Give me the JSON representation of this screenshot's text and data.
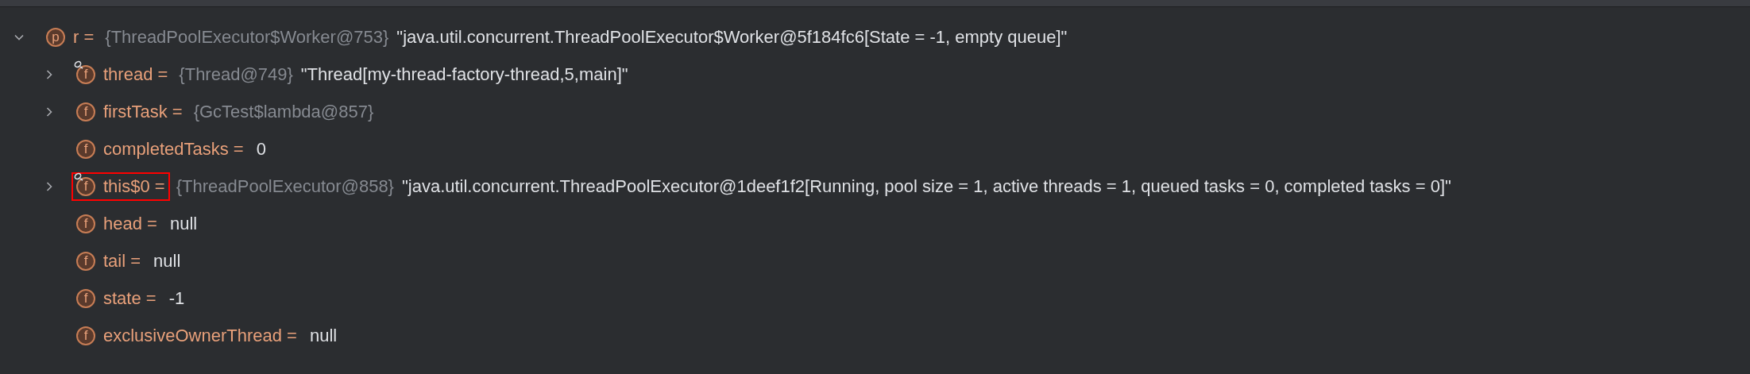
{
  "variables": [
    {
      "icon": "p",
      "label": "r =",
      "type": "{ThreadPoolExecutor$Worker@753}",
      "value": "\"java.util.concurrent.ThreadPoolExecutor$Worker@5f184fc6[State = -1, empty queue]\"",
      "expanded": true,
      "watched": false,
      "highlighted": false,
      "children": [
        {
          "icon": "f",
          "label": "thread =",
          "type": "{Thread@749}",
          "value": "\"Thread[my-thread-factory-thread,5,main]\"",
          "expanded": false,
          "watched": true,
          "highlighted": false
        },
        {
          "icon": "f",
          "label": "firstTask =",
          "type": "{GcTest$lambda@857}",
          "expanded": false,
          "watched": false,
          "highlighted": false
        },
        {
          "icon": "f",
          "label": "completedTasks =",
          "value": "0",
          "watched": false,
          "highlighted": false
        },
        {
          "icon": "f",
          "label": "this$0 =",
          "type": "{ThreadPoolExecutor@858}",
          "value": "\"java.util.concurrent.ThreadPoolExecutor@1deef1f2[Running, pool size = 1, active threads = 1, queued tasks = 0, completed tasks = 0]\"",
          "expanded": false,
          "watched": true,
          "highlighted": true
        },
        {
          "icon": "f",
          "label": "head =",
          "value": "null",
          "watched": false,
          "highlighted": false
        },
        {
          "icon": "f",
          "label": "tail =",
          "value": "null",
          "watched": false,
          "highlighted": false
        },
        {
          "icon": "f",
          "label": "state =",
          "value": "-1",
          "watched": false,
          "highlighted": false
        },
        {
          "icon": "f",
          "label": "exclusiveOwnerThread =",
          "value": "null",
          "watched": false,
          "highlighted": false
        }
      ]
    }
  ]
}
